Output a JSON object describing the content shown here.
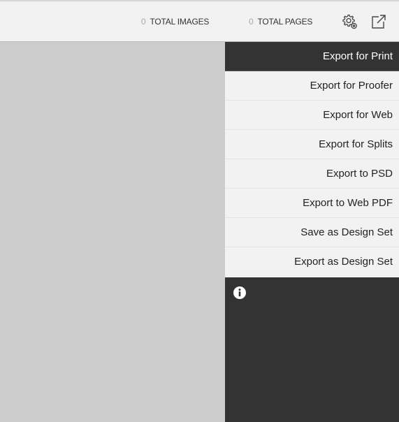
{
  "header": {
    "total_images": {
      "count": "0",
      "label": "TOTAL IMAGES"
    },
    "total_pages": {
      "count": "0",
      "label": "TOTAL PAGES"
    },
    "icons": [
      "settings-gear-icon",
      "export-external-icon"
    ]
  },
  "export_menu": {
    "items": [
      {
        "label": "Export for Print",
        "active": true
      },
      {
        "label": "Export for Proofer",
        "active": false
      },
      {
        "label": "Export for Web",
        "active": false
      },
      {
        "label": "Export for Splits",
        "active": false
      },
      {
        "label": "Export to PSD",
        "active": false
      },
      {
        "label": "Export to Web PDF",
        "active": false
      },
      {
        "label": "Save as Design Set",
        "active": false
      },
      {
        "label": "Export as Design Set",
        "active": false
      }
    ]
  },
  "info_panel": {
    "icon": "info-icon"
  },
  "colors": {
    "panel_dark": "#333333",
    "menu_bg": "#f2f2f2",
    "canvas_bg": "#cccccc"
  }
}
